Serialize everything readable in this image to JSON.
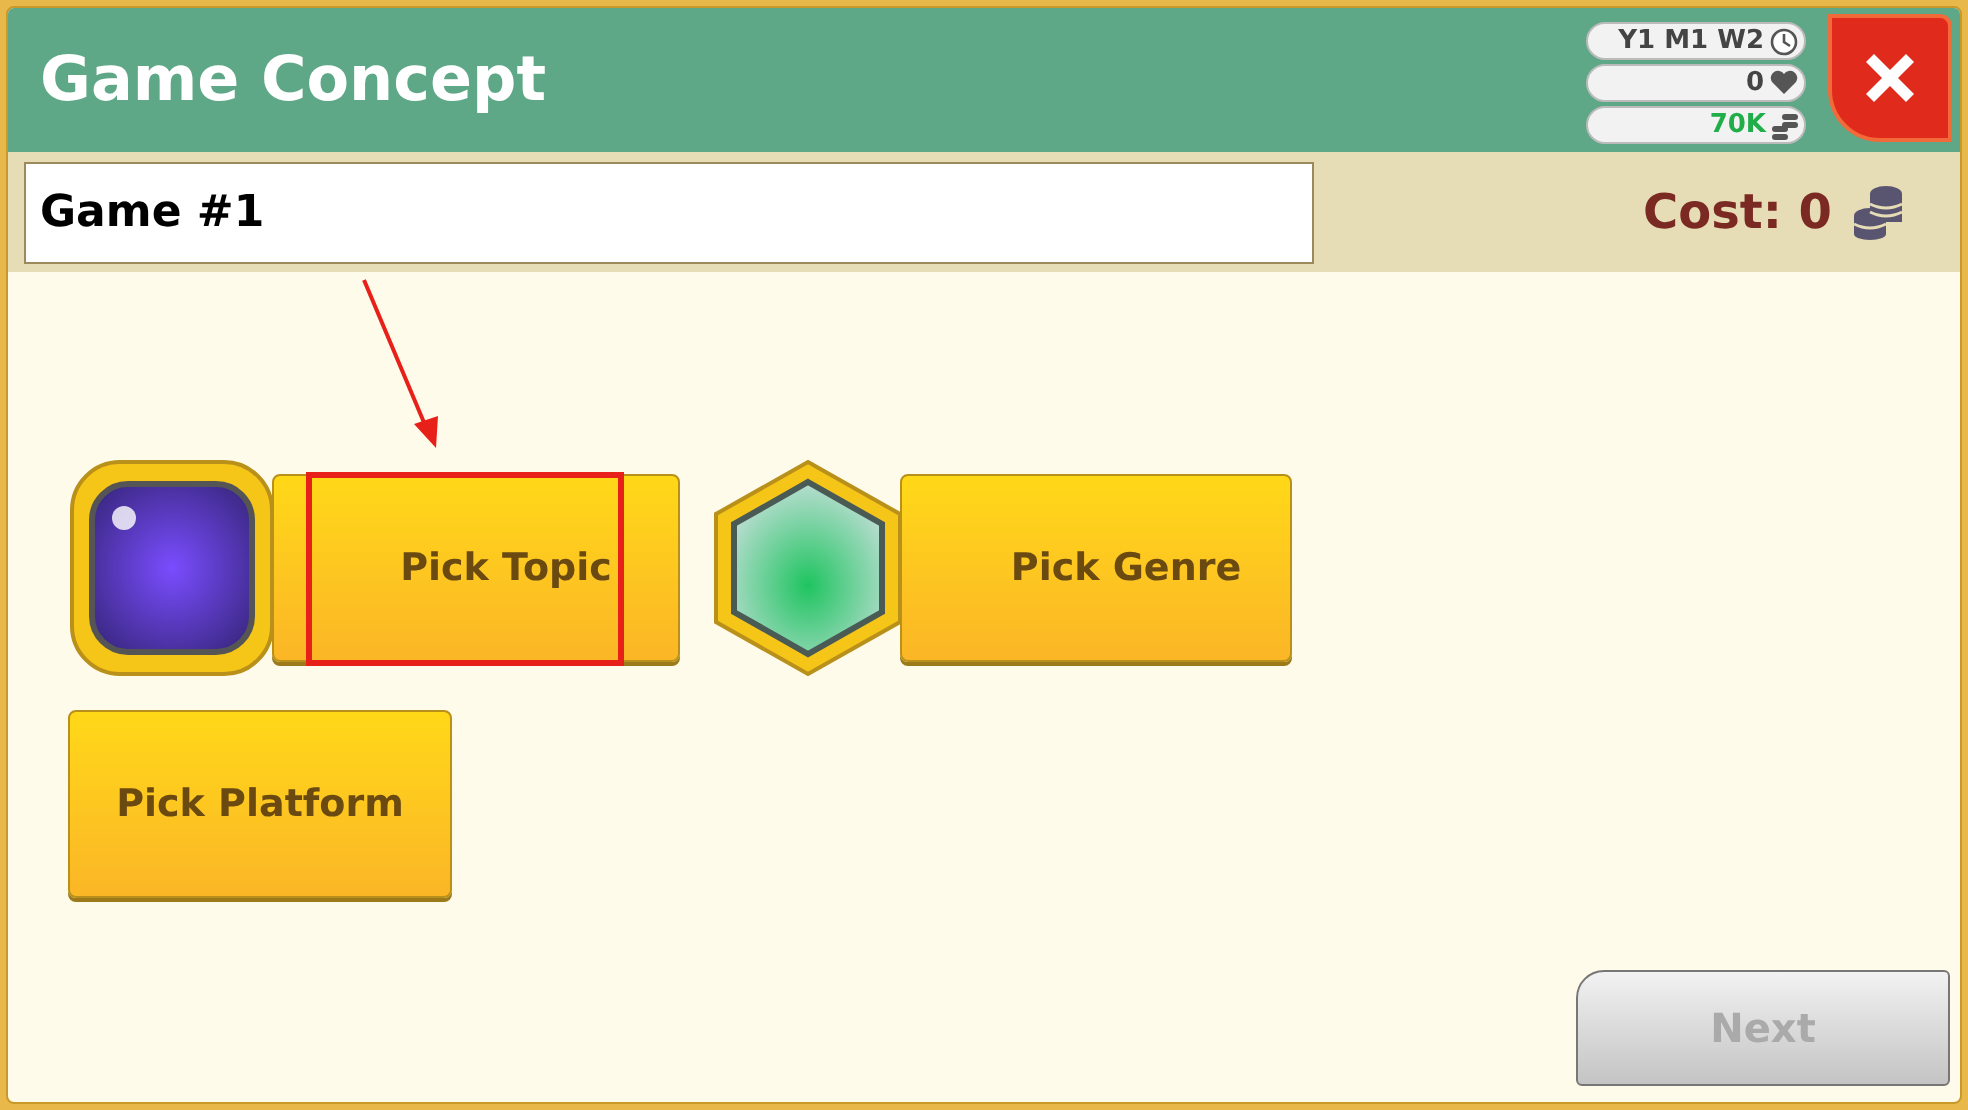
{
  "window": {
    "title": "Game Concept"
  },
  "stats": [
    {
      "kind": "date",
      "text": "Y1 M1 W2"
    },
    {
      "kind": "hearts",
      "text": "0"
    },
    {
      "kind": "money",
      "text": "70K"
    }
  ],
  "name_field": {
    "value": "Game #1"
  },
  "cost": {
    "text": "Cost: 0"
  },
  "picks": [
    {
      "kind": "topic",
      "label": "Pick Topic",
      "highlighted": true
    },
    {
      "kind": "genre",
      "label": "Pick Genre",
      "highlighted": false
    },
    {
      "kind": "platform",
      "label": "Pick Platform",
      "highlighted": false
    }
  ],
  "next_button": {
    "label": "Next",
    "disabled": true
  }
}
